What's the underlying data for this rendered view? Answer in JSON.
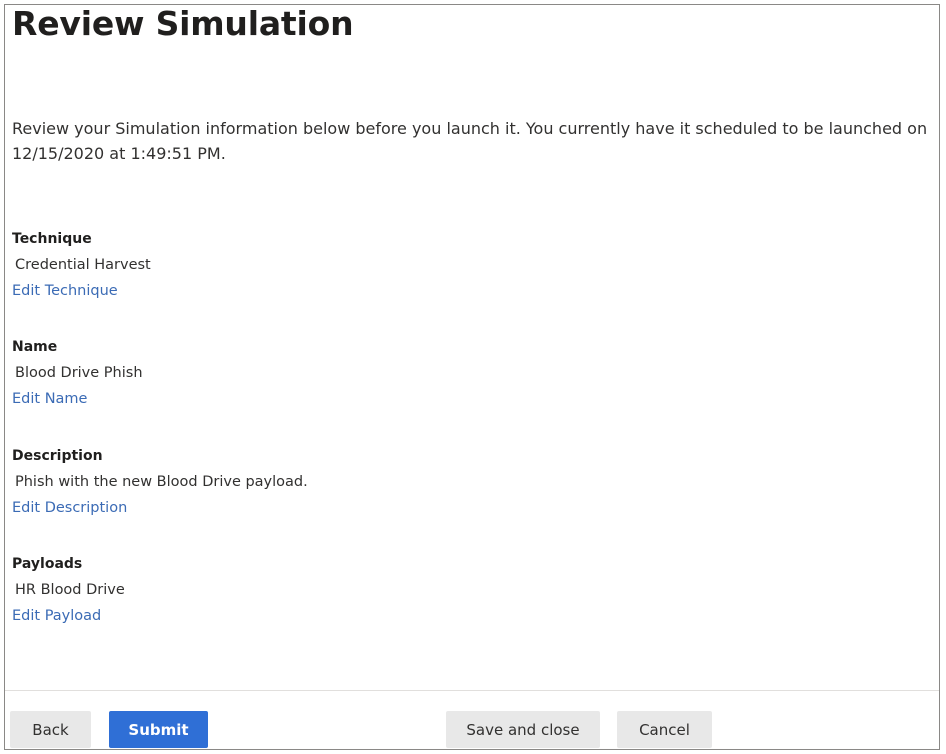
{
  "page": {
    "title": "Review Simulation",
    "intro": "Review your Simulation information below before you launch it. You currently have it scheduled to be launched on 12/15/2020 at 1:49:51 PM."
  },
  "sections": {
    "technique": {
      "label": "Technique",
      "value": "Credential Harvest",
      "edit_link": "Edit Technique"
    },
    "name": {
      "label": "Name",
      "value": "Blood Drive Phish",
      "edit_link": "Edit Name"
    },
    "description": {
      "label": "Description",
      "value": "Phish with the new Blood Drive payload.",
      "edit_link": "Edit Description"
    },
    "payloads": {
      "label": "Payloads",
      "value": "HR Blood Drive",
      "edit_link": "Edit Payload"
    }
  },
  "footer": {
    "back_label": "Back",
    "submit_label": "Submit",
    "save_close_label": "Save and close",
    "cancel_label": "Cancel"
  },
  "colors": {
    "link": "#3b6bb5",
    "primary_button": "#2f6fd6",
    "secondary_button": "#e8e8e8"
  }
}
